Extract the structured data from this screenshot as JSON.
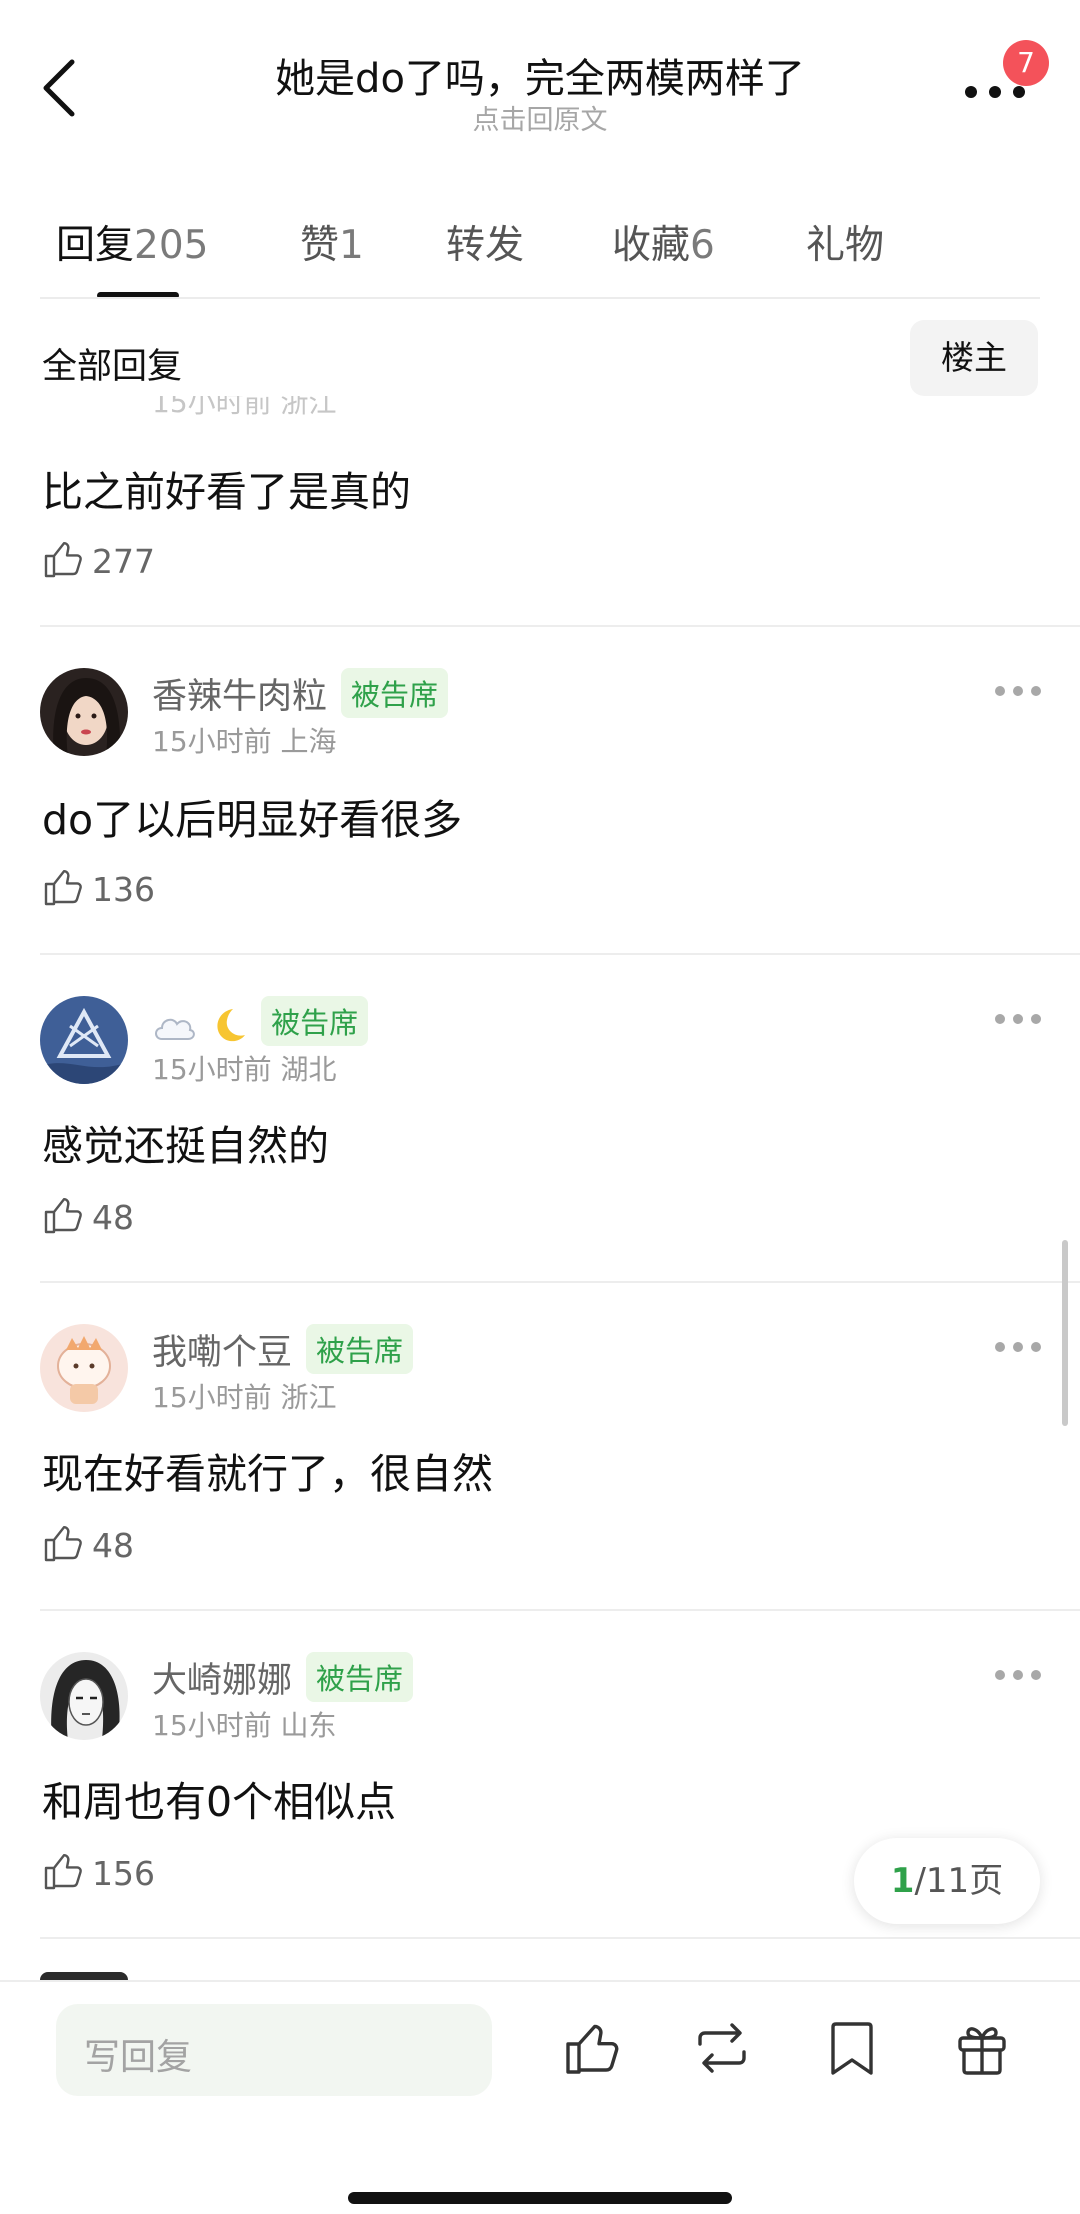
{
  "header": {
    "title": "她是do了吗，完全两模两样了",
    "subtitle": "点击回原文",
    "badge_count": "7"
  },
  "tabs": [
    {
      "label": "回复",
      "count": "205",
      "active": true
    },
    {
      "label": "赞",
      "count": "1"
    },
    {
      "label": "转发",
      "count": ""
    },
    {
      "label": "收藏",
      "count": "6"
    },
    {
      "label": "礼物",
      "count": ""
    }
  ],
  "section": {
    "title": "全部回复",
    "op_button": "楼主"
  },
  "comments": [
    {
      "partial_meta": "15小时前 浙江",
      "content": "比之前好看了是真的",
      "likes": "277"
    },
    {
      "username": "香辣牛肉粒",
      "tag": "被告席",
      "time": "15小时前",
      "location": "上海",
      "content": "do了以后明显好看很多",
      "likes": "136"
    },
    {
      "username": "",
      "tag": "被告席",
      "time": "15小时前",
      "location": "湖北",
      "content": "感觉还挺自然的",
      "likes": "48"
    },
    {
      "username": "我嘞个豆",
      "tag": "被告席",
      "time": "15小时前",
      "location": "浙江",
      "content": "现在好看就行了，很自然",
      "likes": "48"
    },
    {
      "username": "大崎娜娜",
      "tag": "被告席",
      "time": "15小时前",
      "location": "山东",
      "content": "和周也有0个相似点",
      "likes": "156"
    }
  ],
  "pagination": {
    "current": "1",
    "rest": "/11页"
  },
  "bottom_bar": {
    "reply_placeholder": "写回复"
  },
  "colors": {
    "accent_green": "#2fa14a",
    "badge_red": "#f4525a"
  }
}
